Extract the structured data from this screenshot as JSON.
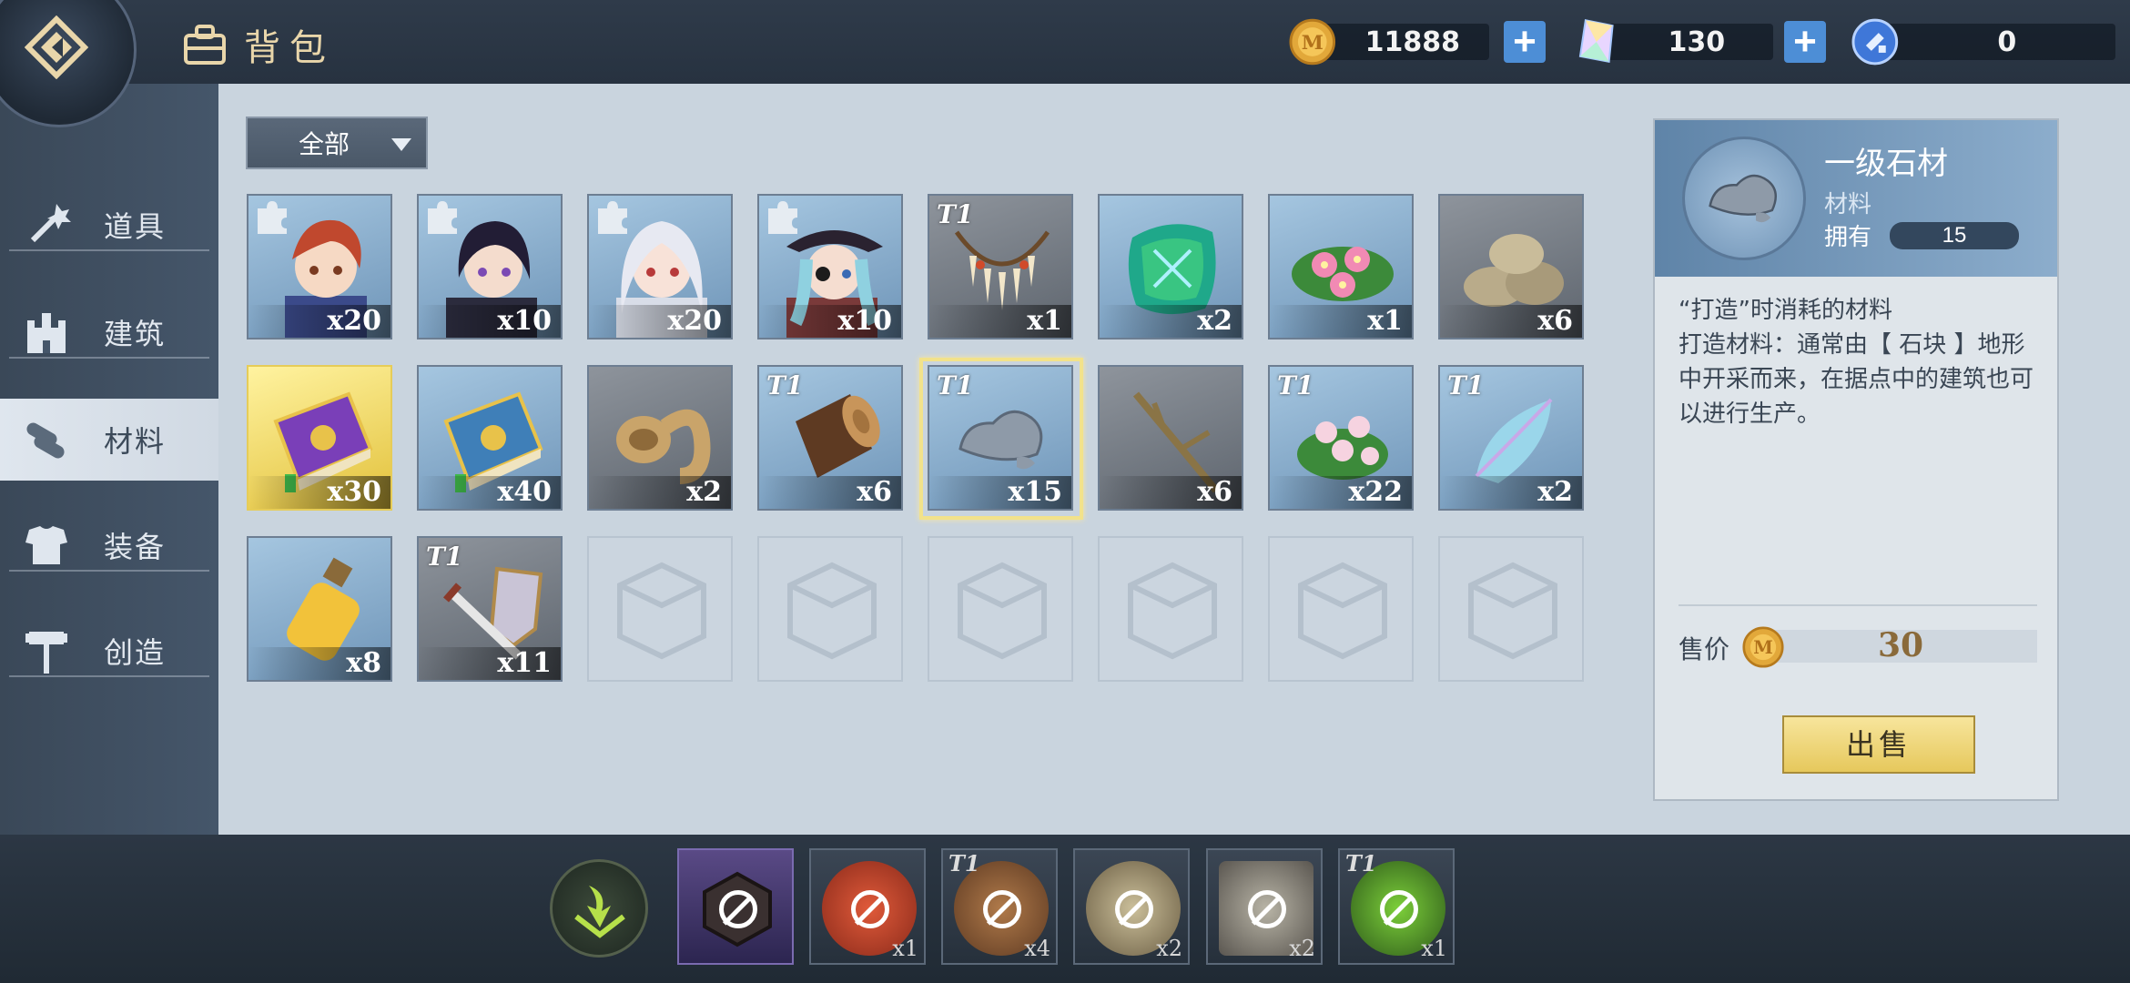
{
  "header": {
    "title": "背包",
    "currencies": [
      {
        "icon": "gold-coin-icon",
        "value": "11888"
      },
      {
        "icon": "crystal-icon",
        "value": "130"
      },
      {
        "icon": "blue-token-icon",
        "value": "0"
      }
    ]
  },
  "sidebar": {
    "items": [
      {
        "label": "道具",
        "icon": "wand-icon"
      },
      {
        "label": "建筑",
        "icon": "castle-icon"
      },
      {
        "label": "材料",
        "icon": "logs-icon"
      },
      {
        "label": "装备",
        "icon": "armor-icon"
      },
      {
        "label": "创造",
        "icon": "hammer-icon"
      }
    ],
    "active": "材料"
  },
  "filter": {
    "selected": "全部"
  },
  "grid": {
    "items": [
      {
        "name": "portrait-red-hair",
        "qty": "x20",
        "tier": "",
        "puzzle": true
      },
      {
        "name": "portrait-dark-hair",
        "qty": "x10",
        "tier": "",
        "puzzle": true
      },
      {
        "name": "portrait-white-hair",
        "qty": "x20",
        "tier": "",
        "puzzle": true
      },
      {
        "name": "portrait-pirate",
        "qty": "x10",
        "tier": "",
        "puzzle": true
      },
      {
        "name": "fang-necklace",
        "qty": "x1",
        "tier": "T1"
      },
      {
        "name": "green-gem",
        "qty": "x2",
        "tier": ""
      },
      {
        "name": "pink-flower",
        "qty": "x1",
        "tier": ""
      },
      {
        "name": "stone-pile",
        "qty": "x6",
        "tier": ""
      },
      {
        "name": "purple-book",
        "qty": "x30",
        "tier": ""
      },
      {
        "name": "blue-book",
        "qty": "x40",
        "tier": ""
      },
      {
        "name": "rope-coil",
        "qty": "x2",
        "tier": ""
      },
      {
        "name": "wood-log",
        "qty": "x6",
        "tier": "T1"
      },
      {
        "name": "grey-stone",
        "qty": "x15",
        "tier": "T1"
      },
      {
        "name": "branch",
        "qty": "x6",
        "tier": ""
      },
      {
        "name": "flower-bush",
        "qty": "x22",
        "tier": "T1"
      },
      {
        "name": "wing-feather",
        "qty": "x2",
        "tier": "T1"
      },
      {
        "name": "gold-potion",
        "qty": "x8",
        "tier": ""
      },
      {
        "name": "sword-shield",
        "qty": "x11",
        "tier": "T1"
      }
    ]
  },
  "detail": {
    "name": "一级石材",
    "type": "材料",
    "own_label": "拥有",
    "own_value": "15",
    "desc_line1": "“打造”时消耗的材料",
    "desc_line2": "打造材料：通常由【 石块 】地形中开采而来，在据点中的建筑也可以进行生产。",
    "price_label": "售价",
    "price": "30",
    "sell_label": "出售"
  },
  "quickbar": {
    "slots": [
      {
        "qty": "",
        "tier": ""
      },
      {
        "qty": "x1",
        "tier": ""
      },
      {
        "qty": "x4",
        "tier": "T1"
      },
      {
        "qty": "x2",
        "tier": ""
      },
      {
        "qty": "x2",
        "tier": ""
      },
      {
        "qty": "x1",
        "tier": "T1"
      }
    ]
  }
}
